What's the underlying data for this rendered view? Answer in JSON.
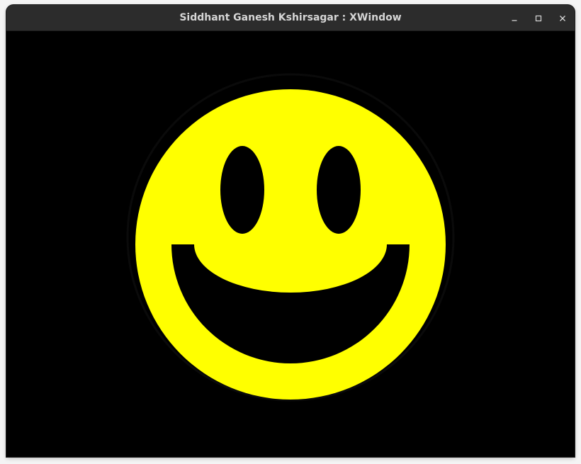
{
  "window": {
    "title": "Siddhant Ganesh Kshirsagar : XWindow"
  },
  "controls": {
    "minimize_icon": "minimize-icon",
    "maximize_icon": "maximize-icon",
    "close_icon": "close-icon"
  },
  "colors": {
    "canvas_background": "#000000",
    "face_fill": "#ffff00",
    "features": "#000000",
    "titlebar": "#2c2c2c",
    "title_text": "#d6d6d6"
  }
}
